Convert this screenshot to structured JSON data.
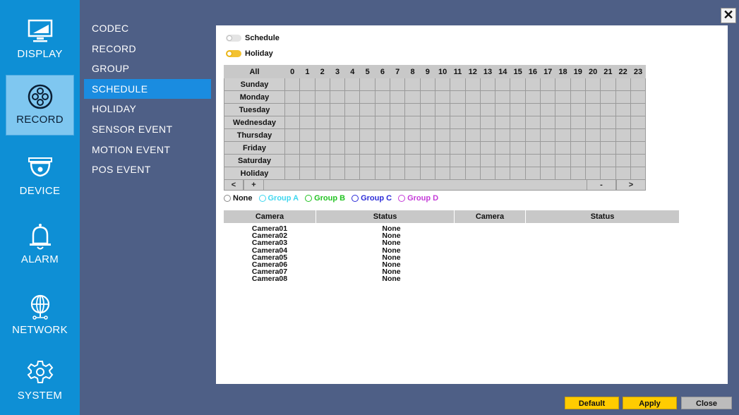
{
  "sidebar": {
    "items": [
      {
        "label": "DISPLAY",
        "icon": "monitor-icon",
        "active": false
      },
      {
        "label": "RECORD",
        "icon": "film-reel-icon",
        "active": true
      },
      {
        "label": "DEVICE",
        "icon": "dome-camera-icon",
        "active": false
      },
      {
        "label": "ALARM",
        "icon": "bell-icon",
        "active": false
      },
      {
        "label": "NETWORK",
        "icon": "globe-icon",
        "active": false
      },
      {
        "label": "SYSTEM",
        "icon": "gear-icon",
        "active": false
      }
    ]
  },
  "submenu": {
    "items": [
      "CODEC",
      "RECORD",
      "GROUP",
      "SCHEDULE",
      "HOLIDAY",
      "SENSOR EVENT",
      "MOTION EVENT",
      "POS EVENT"
    ],
    "active": "SCHEDULE"
  },
  "close_label": "✕",
  "mode": {
    "schedule_label": "Schedule",
    "holiday_label": "Holiday",
    "selected": "Holiday"
  },
  "grid": {
    "all_label": "All",
    "hours": [
      "0",
      "1",
      "2",
      "3",
      "4",
      "5",
      "6",
      "7",
      "8",
      "9",
      "10",
      "11",
      "12",
      "13",
      "14",
      "15",
      "16",
      "17",
      "18",
      "19",
      "20",
      "21",
      "22",
      "23"
    ],
    "days": [
      "Sunday",
      "Monday",
      "Tuesday",
      "Wednesday",
      "Thursday",
      "Friday",
      "Saturday",
      "Holiday"
    ]
  },
  "scroll": {
    "left": "<",
    "plus": "+",
    "minus": "-",
    "right": ">"
  },
  "groups": [
    {
      "label": "None",
      "color": "#888888"
    },
    {
      "label": "Group A",
      "color": "#3fd7ef"
    },
    {
      "label": "Group B",
      "color": "#22c322"
    },
    {
      "label": "Group C",
      "color": "#2b2bd8"
    },
    {
      "label": "Group D",
      "color": "#c43bd8"
    }
  ],
  "camera_table": {
    "headers": [
      "Camera",
      "Status",
      "Camera",
      "Status"
    ],
    "rows": [
      {
        "camera": "Camera01",
        "status": "None"
      },
      {
        "camera": "Camera02",
        "status": "None"
      },
      {
        "camera": "Camera03",
        "status": "None"
      },
      {
        "camera": "Camera04",
        "status": "None"
      },
      {
        "camera": "Camera05",
        "status": "None"
      },
      {
        "camera": "Camera06",
        "status": "None"
      },
      {
        "camera": "Camera07",
        "status": "None"
      },
      {
        "camera": "Camera08",
        "status": "None"
      }
    ]
  },
  "buttons": {
    "default": "Default",
    "apply": "Apply",
    "close": "Close"
  }
}
